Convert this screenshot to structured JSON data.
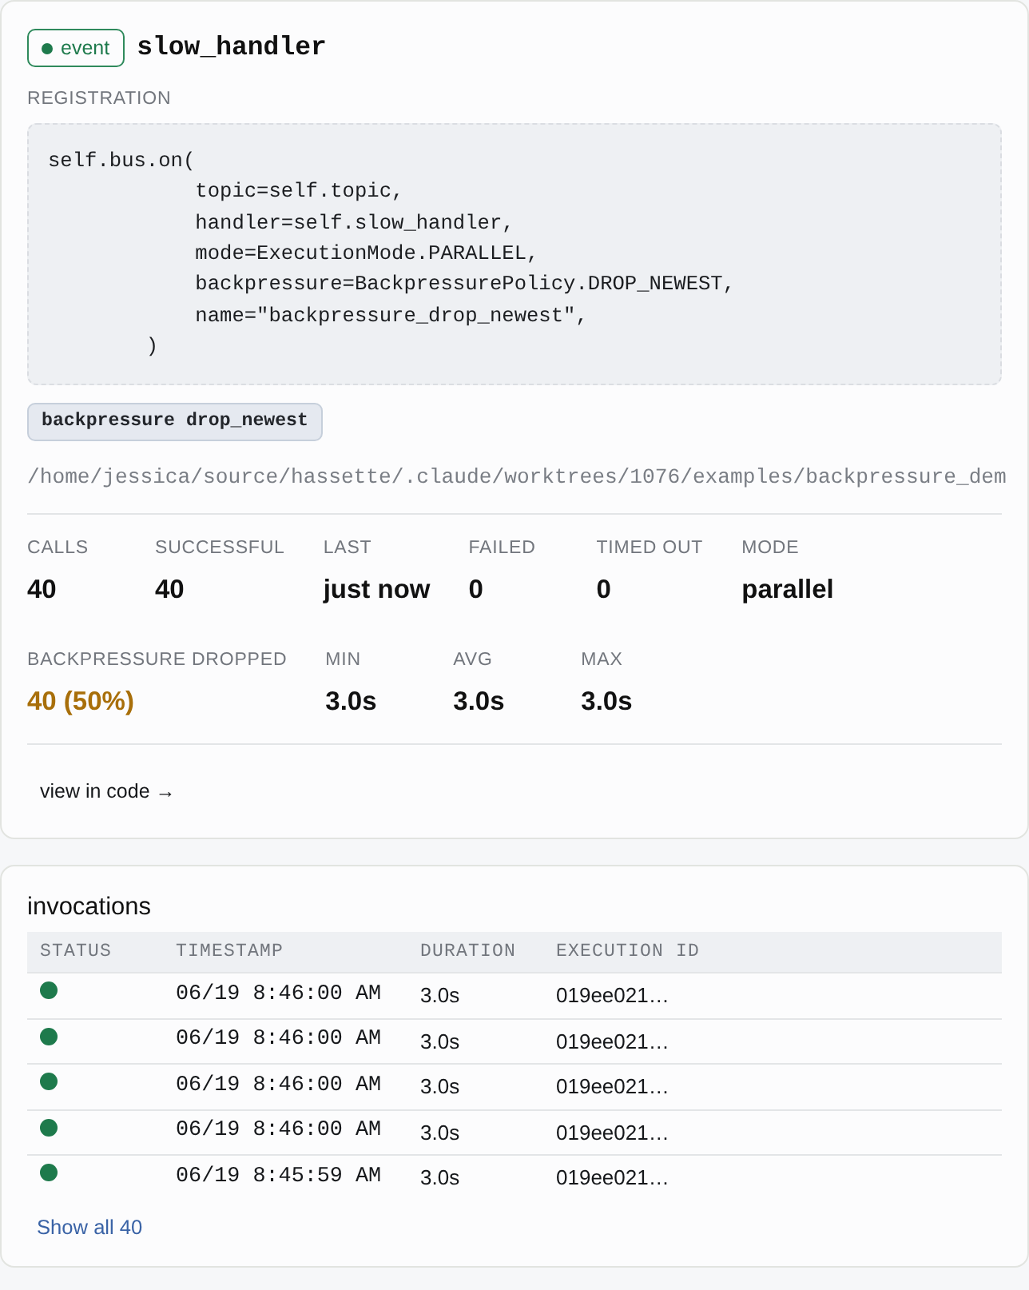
{
  "handler": {
    "badge": {
      "label": "event",
      "kind": "event"
    },
    "name": "slow_handler"
  },
  "registration": {
    "label": "REGISTRATION",
    "code": "self.bus.on(\n            topic=self.topic,\n            handler=self.slow_handler,\n            mode=ExecutionMode.PARALLEL,\n            backpressure=BackpressurePolicy.DROP_NEWEST,\n            name=\"backpressure_drop_newest\",\n        )"
  },
  "tags": [
    "backpressure drop_newest"
  ],
  "source_path": "/home/jessica/source/hassette/.claude/worktrees/1076/examples/backpressure_dem",
  "metrics": [
    [
      {
        "label": "CALLS",
        "value": "40",
        "warning": false
      },
      {
        "label": "SUCCESSFUL",
        "value": "40",
        "warning": false
      },
      {
        "label": "LAST",
        "value": "just now",
        "warning": false
      },
      {
        "label": "FAILED",
        "value": "0",
        "warning": false
      },
      {
        "label": "TIMED OUT",
        "value": "0",
        "warning": false
      },
      {
        "label": "MODE",
        "value": "parallel",
        "warning": false
      }
    ],
    [
      {
        "label": "BACKPRESSURE DROPPED",
        "value": "40 (50%)",
        "warning": true
      },
      {
        "label": "MIN",
        "value": "3.0s",
        "warning": false
      },
      {
        "label": "AVG",
        "value": "3.0s",
        "warning": false
      },
      {
        "label": "MAX",
        "value": "3.0s",
        "warning": false
      }
    ]
  ],
  "view_code_link": "view in code →",
  "invocations": {
    "title": "invocations",
    "columns": [
      "STATUS",
      "TIMESTAMP",
      "DURATION",
      "EXECUTION ID"
    ],
    "rows": [
      {
        "color": "#1e7a4c",
        "timestamp": "06/19 8:46:00 AM",
        "duration": "3.0s",
        "execution_id": "019ee021…"
      },
      {
        "color": "#1e7a4c",
        "timestamp": "06/19 8:46:00 AM",
        "duration": "3.0s",
        "execution_id": "019ee021…"
      },
      {
        "color": "#1e7a4c",
        "timestamp": "06/19 8:46:00 AM",
        "duration": "3.0s",
        "execution_id": "019ee021…"
      },
      {
        "color": "#1e7a4c",
        "timestamp": "06/19 8:46:00 AM",
        "duration": "3.0s",
        "execution_id": "019ee021…"
      },
      {
        "color": "#1e7a4c",
        "timestamp": "06/19 8:45:59 AM",
        "duration": "3.0s",
        "execution_id": "019ee021…"
      }
    ],
    "show_all": "Show all 40"
  }
}
